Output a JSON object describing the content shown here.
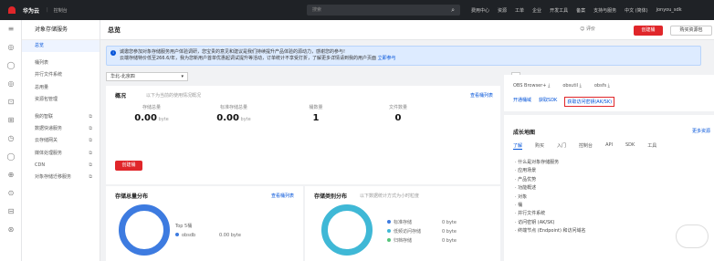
{
  "topbar": {
    "brand": "华为云",
    "console": "控制台",
    "search_placeholder": "搜索",
    "nav": [
      "费用中心",
      "资源",
      "工单",
      "企业",
      "开发工具",
      "备案",
      "支持与服务",
      "中文 (简体)",
      "jonyou_sdk"
    ]
  },
  "sidebar_icons": [
    "≡",
    "◎",
    "◯",
    "◎",
    "⊡",
    "⊞",
    "◷",
    "◯",
    "⊕",
    "⊙",
    "⊟",
    "⊛"
  ],
  "menu": {
    "title": "对象存储服务",
    "items": [
      {
        "label": "总览",
        "active": true
      },
      {
        "label": "桶列表"
      },
      {
        "label": "并行文件系统"
      },
      {
        "label": "总用量"
      },
      {
        "label": "资源包管理"
      },
      {
        "label": "我的智联",
        "ext": "⧉"
      },
      {
        "label": "数据快递服务",
        "ext": "⧉"
      },
      {
        "label": "云存储网关",
        "ext": "⧉"
      },
      {
        "label": "媒体处理服务",
        "ext": "⧉"
      },
      {
        "label": "CDN",
        "ext": "⧉"
      },
      {
        "label": "对象存储迁移服务",
        "ext": "⧉"
      }
    ]
  },
  "header": {
    "title": "总览",
    "rate": "评价",
    "create": "创建桶",
    "buy": "购买资源包"
  },
  "notice": {
    "line1": "诚邀您参加对象存储服务用户体验调研，您宝贵的意见和建议是我们持续提升产品体验的源动力，感谢您的参与!",
    "line2": "云端存储特价低至266.6/年，我为您新用户首单优惠起调试提升等活动，订单统计不享受打折，了解更多详情请到我的用户页面",
    "link": "立即参与"
  },
  "region": "华北-北京四",
  "overview": {
    "title": "概况",
    "sub": "以下为当前的使用情况概况",
    "link": "查看桶列表",
    "metrics": [
      {
        "label": "存储总量",
        "value": "0.00",
        "unit": "byte"
      },
      {
        "label": "标准存储总量",
        "value": "0.00",
        "unit": "byte"
      },
      {
        "label": "桶数量",
        "value": "1",
        "unit": ""
      },
      {
        "label": "文件数量",
        "value": "0",
        "unit": ""
      }
    ],
    "create": "创建桶"
  },
  "dist": {
    "title": "存储总量分布",
    "link": "查看桶列表",
    "top": "Top 5桶",
    "bucket": "obsdb",
    "bucket_val": "0.00 byte"
  },
  "type_dist": {
    "title": "存储类别分布",
    "sub": "以下数据统计方式为小时粒度",
    "items": [
      {
        "label": "标准存储",
        "value": "0 byte",
        "color": "#3d7be0"
      },
      {
        "label": "低频访问存储",
        "value": "0 byte",
        "color": "#3fb8d6"
      },
      {
        "label": "归档存储",
        "value": "0 byte",
        "color": "#55c47a"
      }
    ]
  },
  "tools": {
    "items": [
      "OBS Browser+",
      "obsutil",
      "obsfs"
    ],
    "links": [
      "开通桶域",
      "获取SDK",
      "获取访问密钥(AK/SK)"
    ]
  },
  "growth": {
    "title": "成长地图",
    "more": "更多资源",
    "tabs": [
      "了解",
      "购买",
      "入门",
      "控制台",
      "API",
      "SDK",
      "工具"
    ],
    "list": [
      "什么是对象存储服务",
      "应用场景",
      "产品优势",
      "功能概述",
      "对象",
      "桶",
      "并行文件系统",
      "访问密钥 (AK/SK)",
      "终端节点 (Endpoint) 和访问域名"
    ]
  }
}
